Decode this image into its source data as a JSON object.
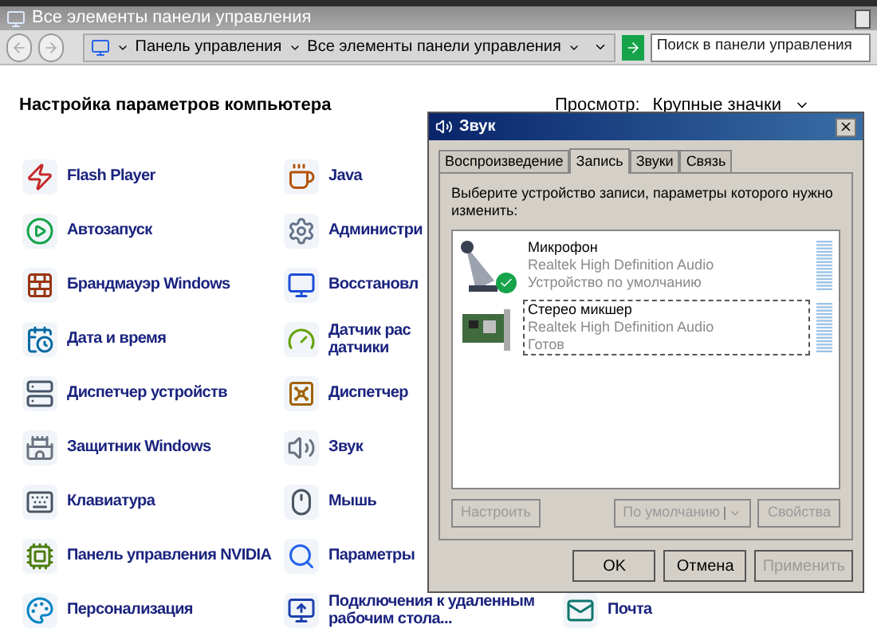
{
  "window": {
    "title": "Все элементы панели управления"
  },
  "breadcrumbs": [
    "Панель управления",
    "Все элементы панели управления"
  ],
  "search": {
    "placeholder": "Поиск в панели управления"
  },
  "heading": "Настройка параметров компьютера",
  "view": {
    "label": "Просмотр:",
    "value": "Крупные значки"
  },
  "rows": [
    [
      "Flash Player",
      "Java"
    ],
    [
      "Автозапуск",
      "Администри"
    ],
    [
      "Брандмауэр Windows",
      "Восстановл"
    ],
    [
      "Дата и время",
      "Датчик рас\nдатчики"
    ],
    [
      "Диспетчер устройств",
      "Диспетчер"
    ],
    [
      "Защитник Windows",
      "Звук"
    ],
    [
      "Клавиатура",
      "Мышь"
    ],
    [
      "Панель управления NVIDIA",
      "Параметры"
    ],
    [
      "Персонализация",
      "Подключения к удаленным\nрабочим стола...",
      "Почта"
    ]
  ],
  "dialog": {
    "title": "Звук",
    "tabs": [
      {
        "label": "Воспроизведение",
        "selected": false
      },
      {
        "label": "Запись",
        "selected": true
      },
      {
        "label": "Звуки",
        "selected": false
      },
      {
        "label": "Связь",
        "selected": false
      }
    ],
    "instruction": "Выберите устройство записи, параметры которого нужно изменить:",
    "devices": [
      {
        "kind": "microphone",
        "name": "Микрофон",
        "driver": "Realtek High Definition Audio",
        "status": "Устройство по умолчанию",
        "default": true,
        "selected": false
      },
      {
        "kind": "card",
        "name": "Стерео микшер",
        "driver": "Realtek High Definition Audio",
        "status": "Готов",
        "default": false,
        "selected": true
      }
    ],
    "device_buttons": [
      {
        "label": "Настроить",
        "disabled": true
      },
      {
        "label": "По умолчанию",
        "disabled": true,
        "dropdown": true
      },
      {
        "label": "Свойства",
        "disabled": true
      }
    ],
    "buttons": [
      {
        "label": "OK",
        "disabled": false
      },
      {
        "label": "Отмена",
        "disabled": false
      },
      {
        "label": "Применить",
        "disabled": true
      }
    ]
  }
}
